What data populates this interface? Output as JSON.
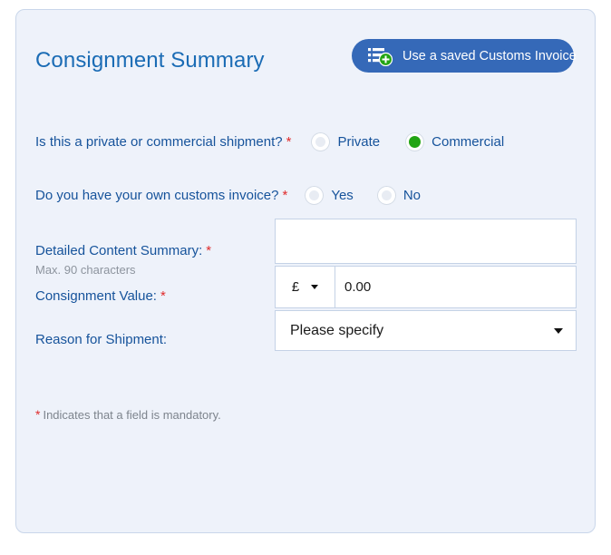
{
  "panel": {
    "title": "Consignment Summary",
    "accent_blue": "#1b6cb5",
    "label_blue": "#16539b",
    "required_red": "#e02b2b",
    "panel_bg": "#eef2fa",
    "panel_border": "#c9d6ea"
  },
  "header": {
    "saved_invoice_button": {
      "label": "Use a saved Customs Invoice",
      "icon": "list-add-icon",
      "bg_color": "#3569b8",
      "badge_color": "#22a413"
    }
  },
  "questions": [
    {
      "label": "Is this a private or commercial shipment?",
      "required_marker": "*",
      "options": [
        {
          "label": "Private",
          "selected": false
        },
        {
          "label": "Commercial",
          "selected": true
        }
      ]
    },
    {
      "label": "Do you have your own customs invoice?",
      "required_marker": "*",
      "options": [
        {
          "label": "Yes",
          "selected": false
        },
        {
          "label": "No",
          "selected": false
        }
      ]
    }
  ],
  "fields": {
    "content_summary": {
      "label": "Detailed Content Summary:",
      "required_marker": "*",
      "hint": "Max. 90 characters",
      "value": "",
      "placeholder": ""
    },
    "consignment_value": {
      "label": "Consignment Value:",
      "required_marker": "*",
      "currency": "£",
      "amount": "0.00",
      "caret_icon": "chevron-down-icon"
    },
    "reason_for_shipment": {
      "label": "Reason for Shipment:",
      "selected": "Please specify",
      "caret_icon": "chevron-down-icon"
    }
  },
  "footer": {
    "required_marker": "*",
    "note": "Indicates that a field is mandatory."
  }
}
